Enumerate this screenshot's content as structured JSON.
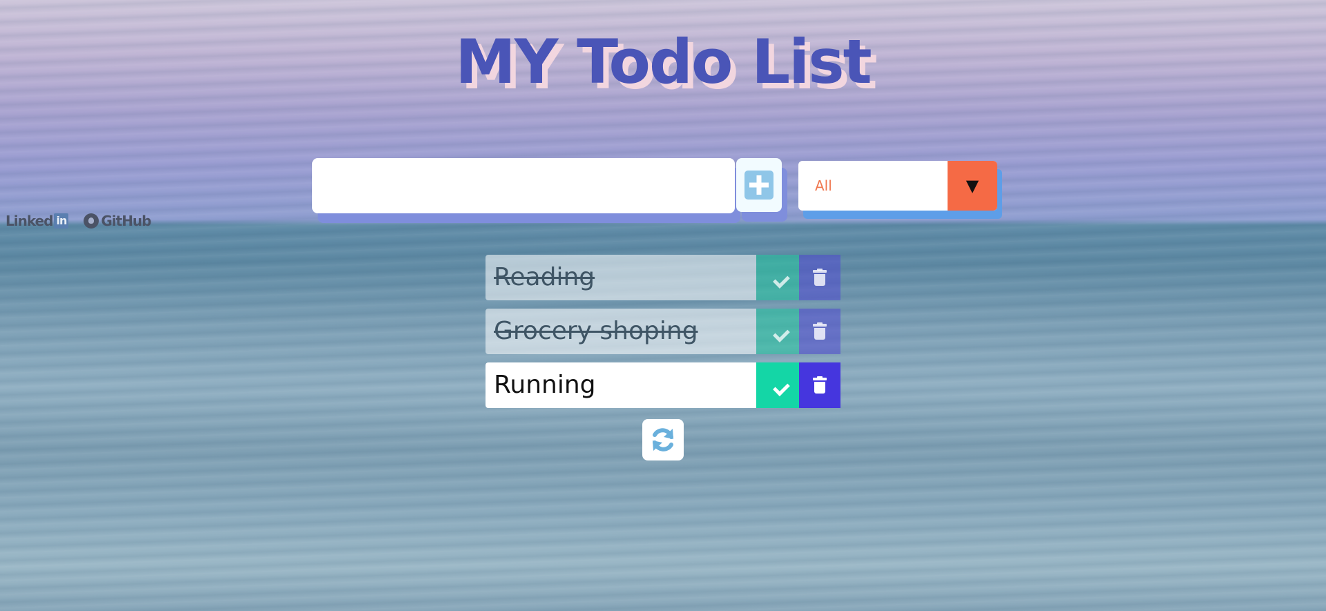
{
  "header": {
    "title": "MY Todo List"
  },
  "add_form": {
    "input_value": "",
    "add_icon": "plus-square-icon"
  },
  "filter": {
    "selected": "All",
    "arrow_glyph": "▼"
  },
  "social": {
    "linkedin_text": "Linked",
    "linkedin_badge": "in",
    "github_text": "GitHub"
  },
  "todos": [
    {
      "label": "Reading",
      "completed": true
    },
    {
      "label": "Grocery shoping",
      "completed": true
    },
    {
      "label": "Running",
      "completed": false
    }
  ],
  "colors": {
    "title": "#4a55b7",
    "title_shadow": "#f2d6df",
    "check": "#14d6a6",
    "trash": "#4536de",
    "filter_accent": "#f56a45"
  },
  "icons": {
    "complete": "check-icon",
    "delete": "trash-icon",
    "refresh": "refresh-icon"
  }
}
